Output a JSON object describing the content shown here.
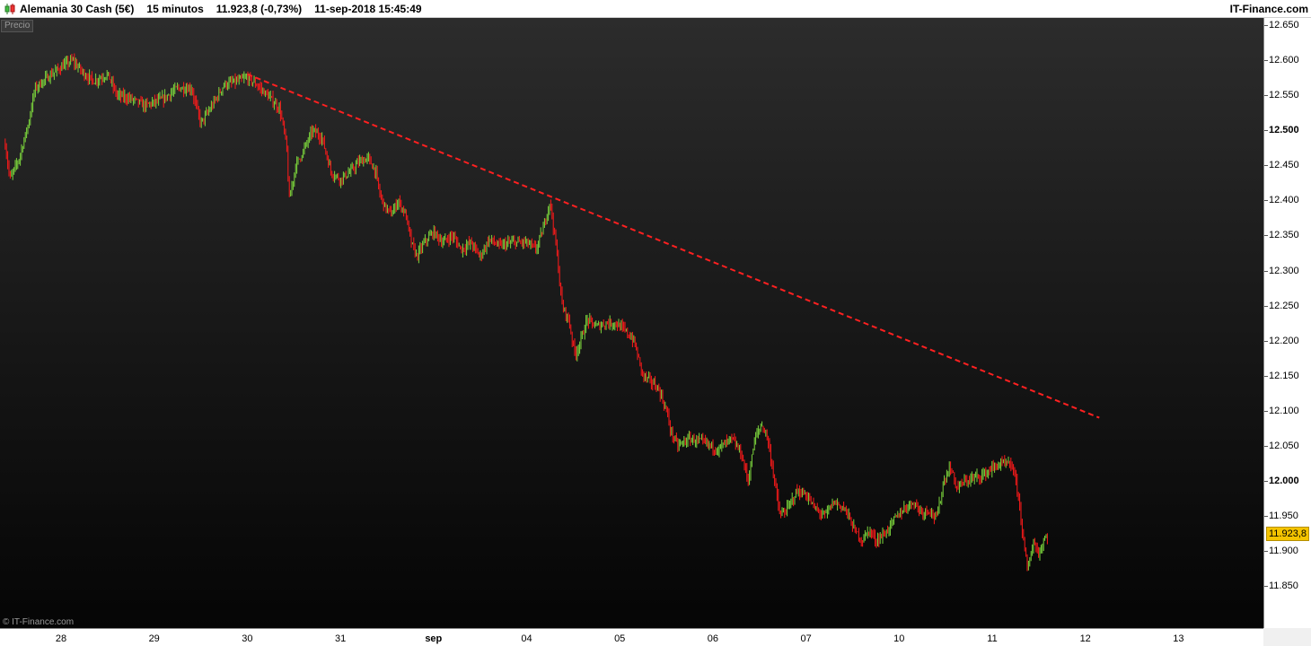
{
  "header": {
    "instrument": "Alemania 30 Cash (5€)",
    "timeframe": "15 minutos",
    "quote": "11.923,8 (-0,73%)",
    "datetime": "11-sep-2018 15:45:49",
    "brand": "IT-Finance.com"
  },
  "series_label": "Precio",
  "watermark": "© IT-Finance.com",
  "colors": {
    "up": "#7cd63c",
    "down": "#ff1a1a",
    "trendline": "#ff2020",
    "price_tag": "#f5c400"
  },
  "last_price_label": "11.923,8",
  "chart_data": {
    "type": "candlestick",
    "ylim": [
      11800,
      12660
    ],
    "y_ticks": [
      {
        "value": 12650,
        "label": "12.650"
      },
      {
        "value": 12600,
        "label": "12.600"
      },
      {
        "value": 12550,
        "label": "12.550"
      },
      {
        "value": 12500,
        "label": "12.500",
        "bold": true
      },
      {
        "value": 12450,
        "label": "12.450"
      },
      {
        "value": 12400,
        "label": "12.400"
      },
      {
        "value": 12350,
        "label": "12.350"
      },
      {
        "value": 12300,
        "label": "12.300"
      },
      {
        "value": 12250,
        "label": "12.250"
      },
      {
        "value": 12200,
        "label": "12.200"
      },
      {
        "value": 12150,
        "label": "12.150"
      },
      {
        "value": 12100,
        "label": "12.100"
      },
      {
        "value": 12050,
        "label": "12.050"
      },
      {
        "value": 12000,
        "label": "12.000",
        "bold": true
      },
      {
        "value": 11950,
        "label": "11.950"
      },
      {
        "value": 11900,
        "label": "11.900"
      },
      {
        "value": 11850,
        "label": "11.850"
      }
    ],
    "x_ticks": [
      {
        "label": "28",
        "day": 0
      },
      {
        "label": "29",
        "day": 1
      },
      {
        "label": "30",
        "day": 2
      },
      {
        "label": "31",
        "day": 3
      },
      {
        "label": "sep",
        "day": 4,
        "bold": true
      },
      {
        "label": "04",
        "day": 5
      },
      {
        "label": "05",
        "day": 6
      },
      {
        "label": "06",
        "day": 7
      },
      {
        "label": "07",
        "day": 8
      },
      {
        "label": "10",
        "day": 9
      },
      {
        "label": "11",
        "day": 10
      },
      {
        "label": "12",
        "day": 11
      },
      {
        "label": "13",
        "day": 12
      }
    ],
    "path": [
      [
        -0.6,
        12480
      ],
      [
        -0.55,
        12430
      ],
      [
        -0.45,
        12460
      ],
      [
        -0.35,
        12510
      ],
      [
        -0.28,
        12560
      ],
      [
        -0.15,
        12575
      ],
      [
        0.0,
        12590
      ],
      [
        0.12,
        12600
      ],
      [
        0.25,
        12580
      ],
      [
        0.35,
        12570
      ],
      [
        0.5,
        12580
      ],
      [
        0.6,
        12550
      ],
      [
        0.75,
        12545
      ],
      [
        0.9,
        12535
      ],
      [
        1.0,
        12540
      ],
      [
        1.1,
        12545
      ],
      [
        1.25,
        12560
      ],
      [
        1.4,
        12560
      ],
      [
        1.5,
        12510
      ],
      [
        1.6,
        12530
      ],
      [
        1.75,
        12565
      ],
      [
        1.9,
        12570
      ],
      [
        2.0,
        12575
      ],
      [
        2.1,
        12565
      ],
      [
        2.25,
        12545
      ],
      [
        2.35,
        12530
      ],
      [
        2.42,
        12480
      ],
      [
        2.45,
        12400
      ],
      [
        2.52,
        12450
      ],
      [
        2.6,
        12470
      ],
      [
        2.7,
        12500
      ],
      [
        2.8,
        12490
      ],
      [
        2.9,
        12440
      ],
      [
        3.0,
        12430
      ],
      [
        3.1,
        12440
      ],
      [
        3.2,
        12455
      ],
      [
        3.3,
        12460
      ],
      [
        3.38,
        12440
      ],
      [
        3.42,
        12410
      ],
      [
        3.48,
        12390
      ],
      [
        3.55,
        12380
      ],
      [
        3.62,
        12400
      ],
      [
        3.7,
        12380
      ],
      [
        3.76,
        12340
      ],
      [
        3.82,
        12320
      ],
      [
        3.9,
        12340
      ],
      [
        4.0,
        12355
      ],
      [
        4.1,
        12340
      ],
      [
        4.2,
        12350
      ],
      [
        4.3,
        12330
      ],
      [
        4.4,
        12340
      ],
      [
        4.5,
        12320
      ],
      [
        4.6,
        12345
      ],
      [
        4.7,
        12335
      ],
      [
        4.85,
        12340
      ],
      [
        5.0,
        12340
      ],
      [
        5.1,
        12330
      ],
      [
        5.18,
        12360
      ],
      [
        5.25,
        12400
      ],
      [
        5.32,
        12330
      ],
      [
        5.38,
        12250
      ],
      [
        5.45,
        12230
      ],
      [
        5.52,
        12180
      ],
      [
        5.58,
        12200
      ],
      [
        5.65,
        12230
      ],
      [
        5.75,
        12220
      ],
      [
        5.85,
        12225
      ],
      [
        5.95,
        12225
      ],
      [
        6.05,
        12215
      ],
      [
        6.15,
        12200
      ],
      [
        6.25,
        12150
      ],
      [
        6.35,
        12140
      ],
      [
        6.42,
        12130
      ],
      [
        6.5,
        12100
      ],
      [
        6.55,
        12070
      ],
      [
        6.62,
        12050
      ],
      [
        6.75,
        12060
      ],
      [
        6.9,
        12055
      ],
      [
        7.05,
        12045
      ],
      [
        7.2,
        12060
      ],
      [
        7.3,
        12040
      ],
      [
        7.38,
        12000
      ],
      [
        7.45,
        12060
      ],
      [
        7.52,
        12080
      ],
      [
        7.58,
        12065
      ],
      [
        7.65,
        12010
      ],
      [
        7.72,
        11950
      ],
      [
        7.8,
        11960
      ],
      [
        7.9,
        11985
      ],
      [
        8.0,
        11980
      ],
      [
        8.1,
        11960
      ],
      [
        8.2,
        11950
      ],
      [
        8.3,
        11970
      ],
      [
        8.42,
        11960
      ],
      [
        8.52,
        11930
      ],
      [
        8.6,
        11915
      ],
      [
        8.68,
        11930
      ],
      [
        8.75,
        11915
      ],
      [
        8.85,
        11925
      ],
      [
        8.95,
        11945
      ],
      [
        9.05,
        11960
      ],
      [
        9.15,
        11970
      ],
      [
        9.25,
        11955
      ],
      [
        9.32,
        11960
      ],
      [
        9.4,
        11945
      ],
      [
        9.48,
        12000
      ],
      [
        9.55,
        12020
      ],
      [
        9.62,
        11990
      ],
      [
        9.72,
        12000
      ],
      [
        9.82,
        12005
      ],
      [
        9.92,
        12010
      ],
      [
        10.02,
        12020
      ],
      [
        10.12,
        12025
      ],
      [
        10.22,
        12020
      ],
      [
        10.28,
        11980
      ],
      [
        10.33,
        11920
      ],
      [
        10.38,
        11870
      ],
      [
        10.44,
        11915
      ],
      [
        10.5,
        11895
      ],
      [
        10.55,
        11915
      ],
      [
        10.6,
        11923.8
      ]
    ],
    "trendline": {
      "from": [
        2.0,
        12580
      ],
      "to": [
        11.15,
        12090
      ]
    }
  }
}
